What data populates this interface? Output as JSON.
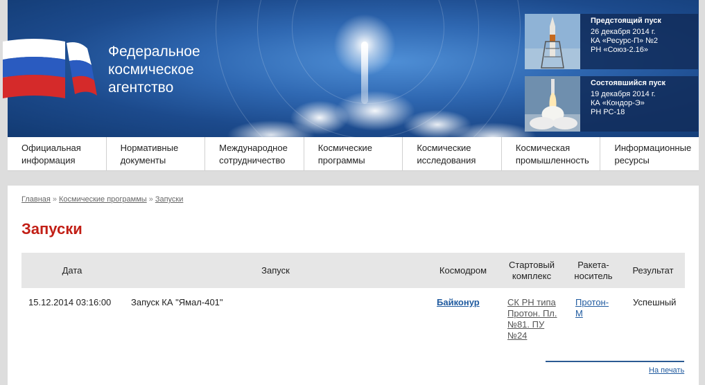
{
  "header": {
    "agency_title_lines": [
      "Федеральное",
      "космическое",
      "агентство"
    ]
  },
  "upcoming_launch": {
    "heading": "Предстоящий пуск",
    "date": "26 декабря 2014 г.",
    "spacecraft": "КА «Ресурс-П» №2",
    "rocket": "РН «Союз-2.16»"
  },
  "completed_launch": {
    "heading": "Состоявшийся пуск",
    "date": "19 декабря 2014 г.",
    "spacecraft": "КА «Кондор-Э»",
    "rocket": "РН РС-18"
  },
  "nav": {
    "items": [
      {
        "line1": "Официальная",
        "line2": "информация"
      },
      {
        "line1": "Нормативные",
        "line2": "документы"
      },
      {
        "line1": "Международное",
        "line2": "сотрудничество"
      },
      {
        "line1": "Космические",
        "line2": "программы"
      },
      {
        "line1": "Космические",
        "line2": "исследования"
      },
      {
        "line1": "Космическая",
        "line2": "промышленность"
      },
      {
        "line1": "Информационные",
        "line2": "ресурсы"
      }
    ]
  },
  "breadcrumb": {
    "items": [
      "Главная",
      "Космические программы",
      "Запуски"
    ],
    "separator": "»"
  },
  "page": {
    "title": "Запуски"
  },
  "table": {
    "headers": {
      "date": "Дата",
      "launch": "Запуск",
      "cosmodrome": "Космодром",
      "complex_line1": "Стартовый",
      "complex_line2": "комплекс",
      "rocket_line1": "Ракета-",
      "rocket_line2": "носитель",
      "result": "Результат"
    },
    "rows": [
      {
        "date": "15.12.2014 03:16:00",
        "launch": "Запуск КА \"Ямал-401\"",
        "cosmodrome": "Байконур",
        "complex_lines": [
          "СК РН типа",
          "Протон. Пл.",
          "№81. ПУ",
          "№24"
        ],
        "rocket": "Протон-М",
        "result": "Успешный"
      }
    ]
  },
  "footer": {
    "print_label": "На печать"
  },
  "colors": {
    "title_red": "#c21f16",
    "link_blue": "#1f5a9f",
    "banner_blue": "#1c4a8c"
  }
}
